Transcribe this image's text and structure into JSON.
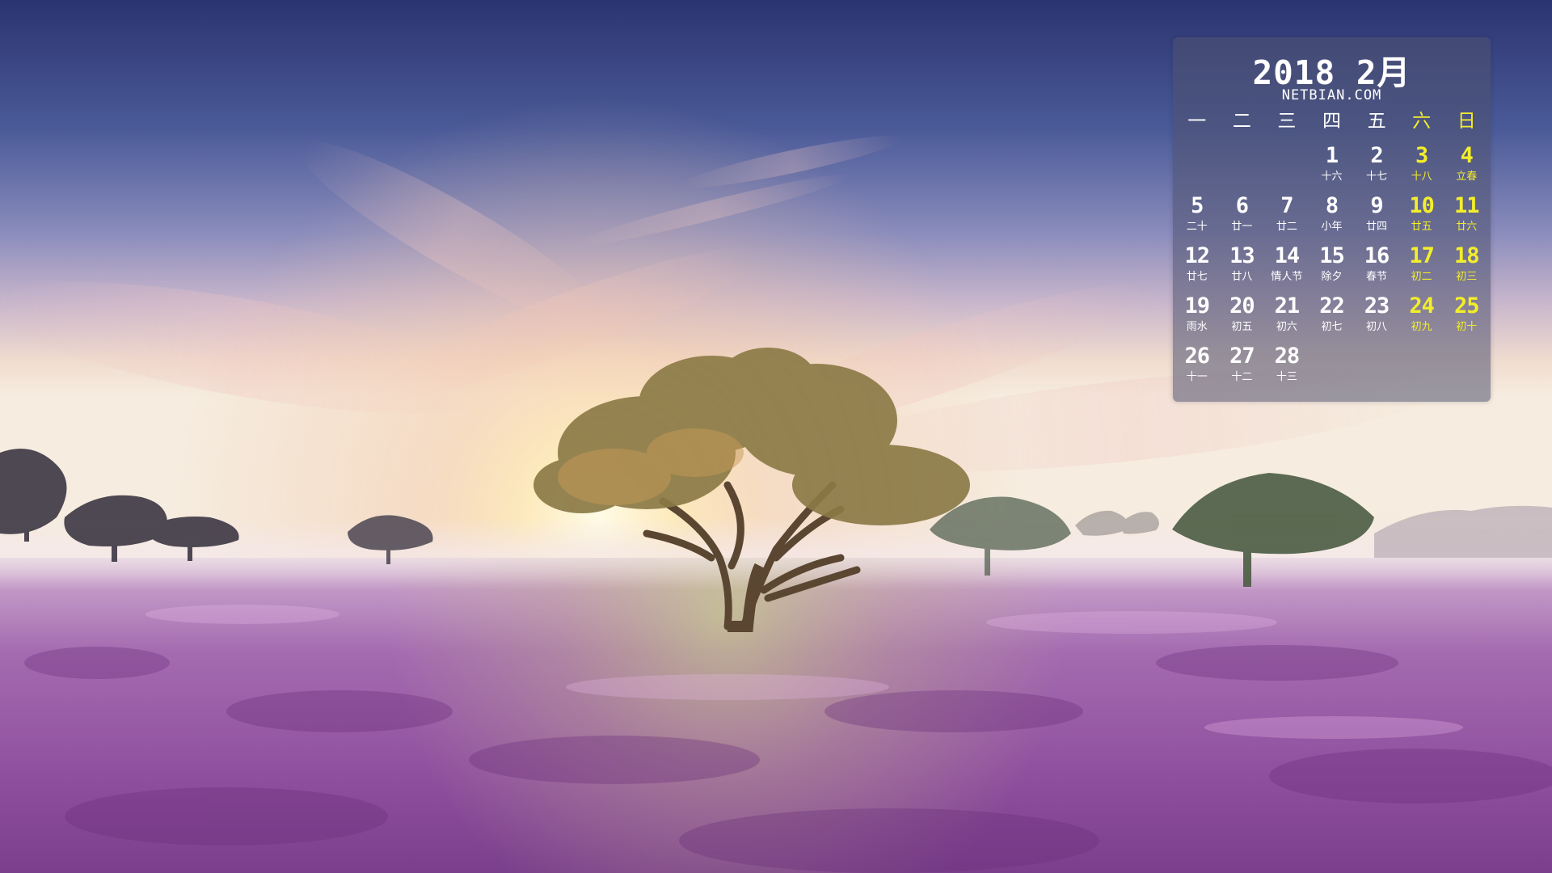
{
  "calendar": {
    "title": "2018 2月",
    "site": "NETBIAN.COM",
    "colors": {
      "weekday": "#ffffff",
      "weekend": "#f3ee2a"
    },
    "weekdays": [
      "一",
      "二",
      "三",
      "四",
      "五",
      "六",
      "日"
    ],
    "days": [
      {
        "day": "",
        "lunar": ""
      },
      {
        "day": "",
        "lunar": ""
      },
      {
        "day": "",
        "lunar": ""
      },
      {
        "day": "1",
        "lunar": "十六"
      },
      {
        "day": "2",
        "lunar": "十七"
      },
      {
        "day": "3",
        "lunar": "十八"
      },
      {
        "day": "4",
        "lunar": "立春"
      },
      {
        "day": "5",
        "lunar": "二十"
      },
      {
        "day": "6",
        "lunar": "廿一"
      },
      {
        "day": "7",
        "lunar": "廿二"
      },
      {
        "day": "8",
        "lunar": "小年"
      },
      {
        "day": "9",
        "lunar": "廿四"
      },
      {
        "day": "10",
        "lunar": "廿五"
      },
      {
        "day": "11",
        "lunar": "廿六"
      },
      {
        "day": "12",
        "lunar": "廿七"
      },
      {
        "day": "13",
        "lunar": "廿八"
      },
      {
        "day": "14",
        "lunar": "情人节"
      },
      {
        "day": "15",
        "lunar": "除夕"
      },
      {
        "day": "16",
        "lunar": "春节"
      },
      {
        "day": "17",
        "lunar": "初二"
      },
      {
        "day": "18",
        "lunar": "初三"
      },
      {
        "day": "19",
        "lunar": "雨水"
      },
      {
        "day": "20",
        "lunar": "初五"
      },
      {
        "day": "21",
        "lunar": "初六"
      },
      {
        "day": "22",
        "lunar": "初七"
      },
      {
        "day": "23",
        "lunar": "初八"
      },
      {
        "day": "24",
        "lunar": "初九"
      },
      {
        "day": "25",
        "lunar": "初十"
      },
      {
        "day": "26",
        "lunar": "十一"
      },
      {
        "day": "27",
        "lunar": "十二"
      },
      {
        "day": "28",
        "lunar": "十三"
      }
    ]
  }
}
